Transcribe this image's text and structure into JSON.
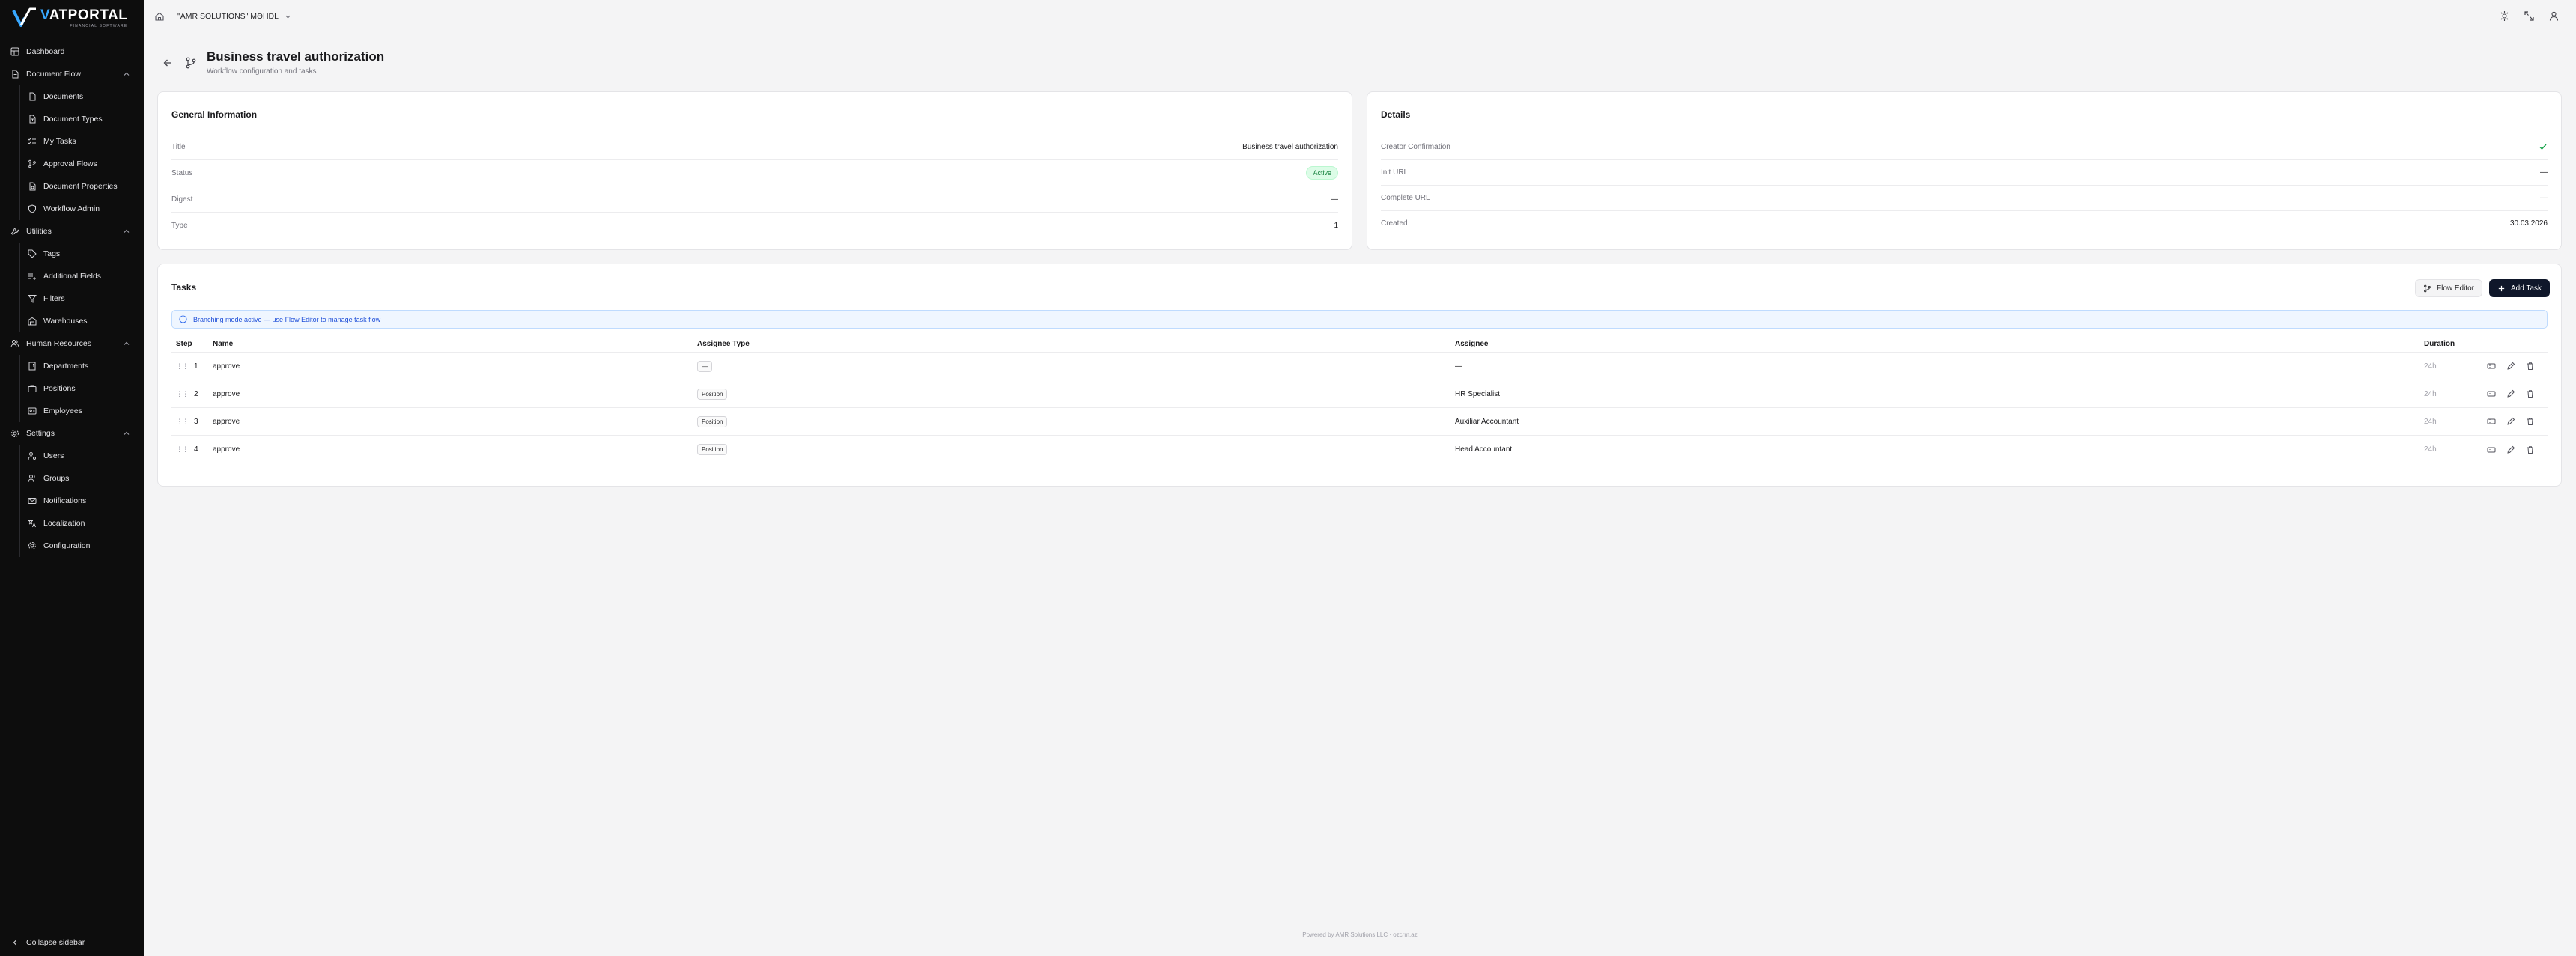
{
  "brand": {
    "name_v": "V",
    "name_rest": "ATPORTAL",
    "tagline": "FINANCIAL SOFTWARE",
    "accent": "#38a8ff"
  },
  "sidebar": {
    "dashboard": "Dashboard",
    "document_flow": "Document Flow",
    "documents": "Documents",
    "document_types": "Document Types",
    "my_tasks": "My Tasks",
    "approval_flows": "Approval Flows",
    "document_properties": "Document Properties",
    "workflow_admin": "Workflow Admin",
    "utilities": "Utilities",
    "tags": "Tags",
    "additional_fields": "Additional Fields",
    "filters": "Filters",
    "warehouses": "Warehouses",
    "human_resources": "Human Resources",
    "departments": "Departments",
    "positions": "Positions",
    "employees": "Employees",
    "settings": "Settings",
    "users": "Users",
    "groups": "Groups",
    "notifications": "Notifications",
    "localization": "Localization",
    "configuration": "Configuration",
    "collapse": "Collapse sidebar"
  },
  "topbar": {
    "org": "\"AMR SOLUTIONS\" MƏHDL"
  },
  "header": {
    "title": "Business travel authorization",
    "subtitle": "Workflow configuration and tasks"
  },
  "general": {
    "heading": "General Information",
    "title_label": "Title",
    "title_value": "Business travel authorization",
    "status_label": "Status",
    "status_value": "Active",
    "digest_label": "Digest",
    "digest_value": "—",
    "type_label": "Type",
    "type_value": "1"
  },
  "details": {
    "heading": "Details",
    "creator_label": "Creator Confirmation",
    "init_label": "Init URL",
    "init_value": "—",
    "complete_label": "Complete URL",
    "complete_value": "—",
    "created_label": "Created",
    "created_value": "30.03.2026"
  },
  "tasks": {
    "heading": "Tasks",
    "flow_editor": "Flow Editor",
    "add_task": "Add Task",
    "banner": "Branching mode active — use Flow Editor to manage task flow",
    "columns": {
      "step": "Step",
      "name": "Name",
      "assignee_type": "Assignee Type",
      "assignee": "Assignee",
      "duration": "Duration"
    },
    "rows": [
      {
        "step": "1",
        "name": "approve",
        "assignee_type": "—",
        "assignee": "—",
        "duration": "24h"
      },
      {
        "step": "2",
        "name": "approve",
        "assignee_type": "Position",
        "assignee": "HR Specialist",
        "duration": "24h"
      },
      {
        "step": "3",
        "name": "approve",
        "assignee_type": "Position",
        "assignee": "Auxiliar Accountant",
        "duration": "24h"
      },
      {
        "step": "4",
        "name": "approve",
        "assignee_type": "Position",
        "assignee": "Head Accountant",
        "duration": "24h"
      }
    ]
  },
  "footer": "Powered by AMR Solutions LLC · ozcrm.az"
}
